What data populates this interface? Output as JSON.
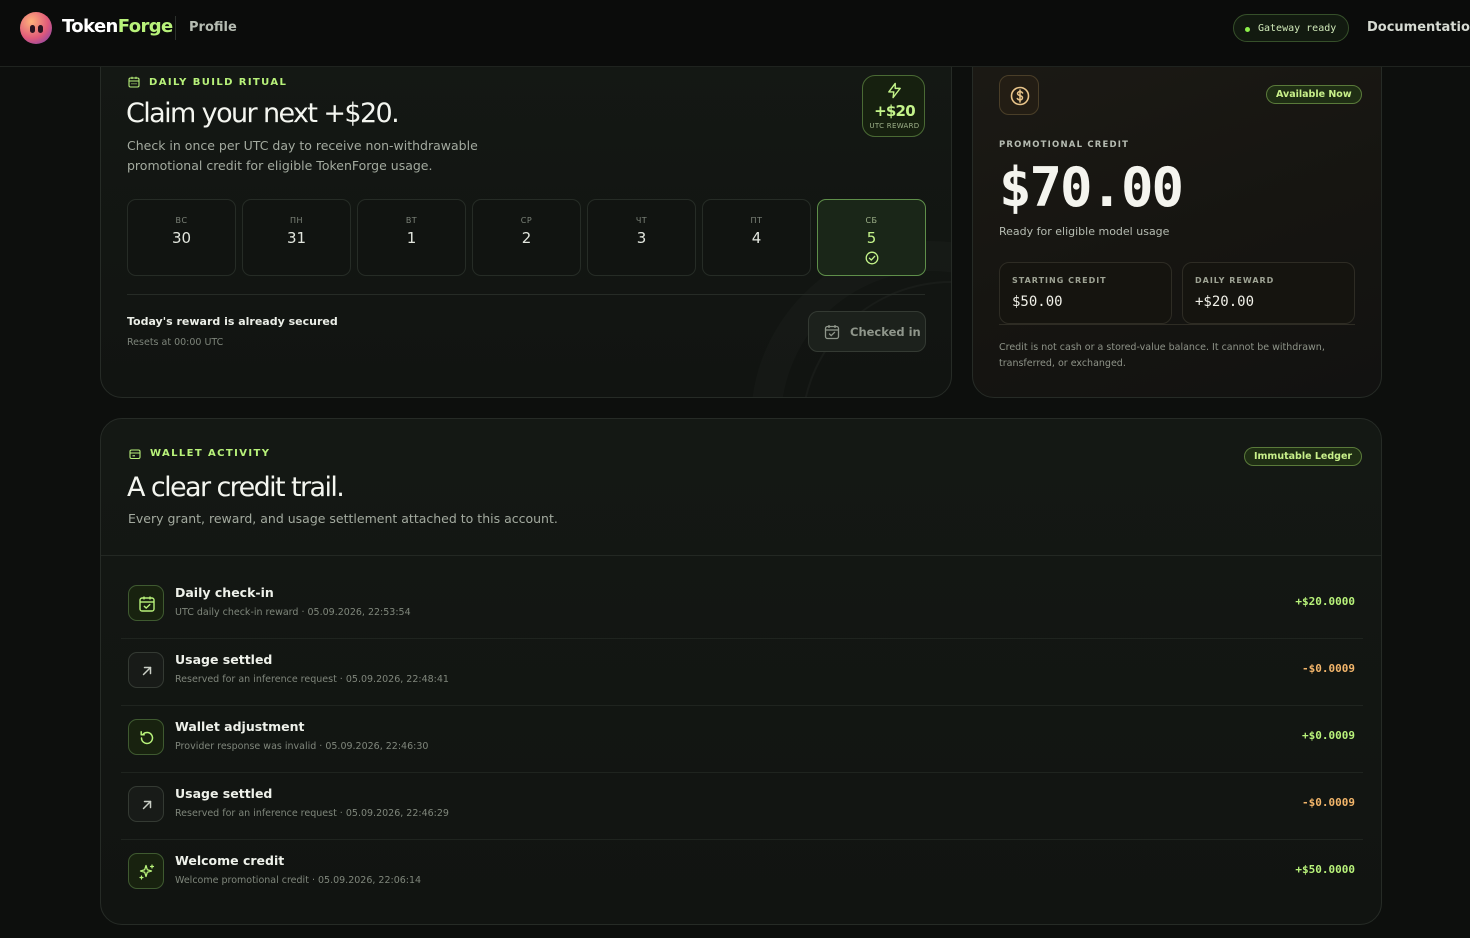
{
  "header": {
    "brand_part1": "Token",
    "brand_part2": "Forge",
    "profile_label": "Profile",
    "gateway_status": "Gateway ready",
    "docs_label": "Documentation"
  },
  "ritual": {
    "eyebrow": "DAILY BUILD RITUAL",
    "title": "Claim your next +$20.",
    "description_line1": "Check in once per UTC day to receive non-withdrawable",
    "description_line2": "promotional credit for eligible TokenForge usage.",
    "badge_amount": "+$20",
    "badge_label": "UTC REWARD",
    "days": [
      {
        "name": "ВС",
        "date": "30"
      },
      {
        "name": "ПН",
        "date": "31"
      },
      {
        "name": "ВТ",
        "date": "1"
      },
      {
        "name": "СР",
        "date": "2"
      },
      {
        "name": "ЧТ",
        "date": "3"
      },
      {
        "name": "ПТ",
        "date": "4"
      },
      {
        "name": "СБ",
        "date": "5",
        "active": true
      }
    ],
    "status_title": "Today's reward is already secured",
    "status_sub": "Resets at 00:00 UTC",
    "checked_button": "Checked in"
  },
  "credit": {
    "badge": "Available Now",
    "label": "PROMOTIONAL CREDIT",
    "amount": "$70.00",
    "sub": "Ready for eligible model usage",
    "starting_label": "STARTING CREDIT",
    "starting_value": "$50.00",
    "daily_label": "DAILY REWARD",
    "daily_value": "+$20.00",
    "note": "Credit is not cash or a stored-value balance. It cannot be withdrawn, transferred, or exchanged."
  },
  "wallet": {
    "eyebrow": "WALLET ACTIVITY",
    "title": "A clear credit trail.",
    "description": "Every grant, reward, and usage settlement attached to this account.",
    "badge": "Immutable Ledger",
    "rows": [
      {
        "icon": "calendar-check-icon",
        "title": "Daily check-in",
        "sub": "UTC daily check-in reward · 05.09.2026, 22:53:54",
        "amount": "+$20.0000",
        "sign": "pos"
      },
      {
        "icon": "arrow-up-right-icon",
        "title": "Usage settled",
        "sub": "Reserved for an inference request · 05.09.2026, 22:48:41",
        "amount": "-$0.0009",
        "sign": "neg"
      },
      {
        "icon": "rotate-ccw-icon",
        "title": "Wallet adjustment",
        "sub": "Provider response was invalid · 05.09.2026, 22:46:30",
        "amount": "+$0.0009",
        "sign": "pos"
      },
      {
        "icon": "arrow-up-right-icon",
        "title": "Usage settled",
        "sub": "Reserved for an inference request · 05.09.2026, 22:46:29",
        "amount": "-$0.0009",
        "sign": "neg"
      },
      {
        "icon": "sparkles-icon",
        "title": "Welcome credit",
        "sub": "Welcome promotional credit · 05.09.2026, 22:06:14",
        "amount": "+$50.0000",
        "sign": "pos"
      }
    ]
  },
  "colors": {
    "accent": "#b8f27a",
    "negative": "#f2b56a",
    "background": "#0d0f0d"
  }
}
